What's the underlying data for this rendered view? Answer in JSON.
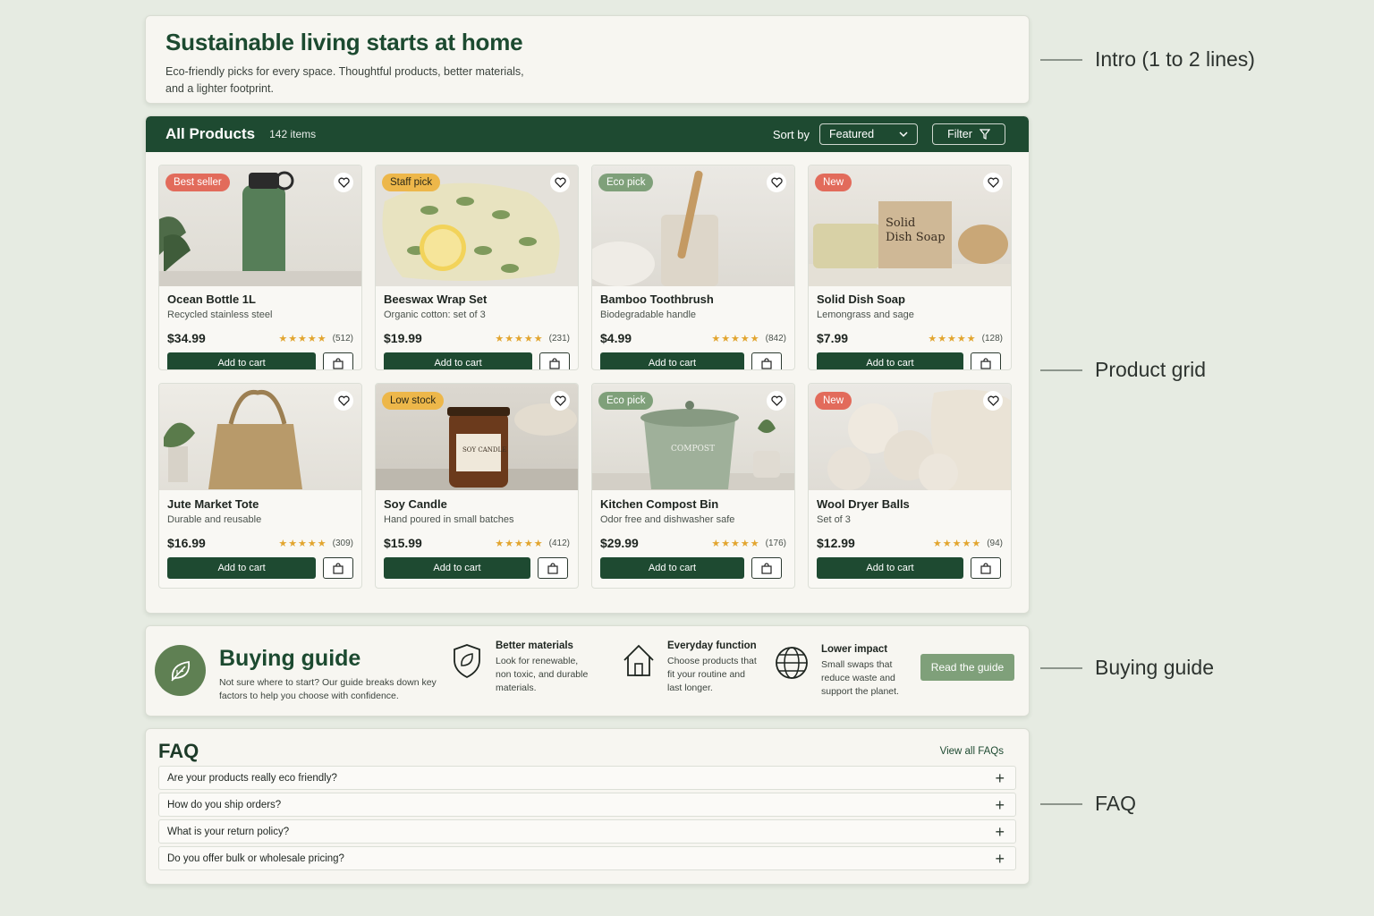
{
  "intro": {
    "title": "Sustainable living starts at home",
    "description": "Eco-friendly picks for every space. Thoughtful products, better materials, and a lighter footprint."
  },
  "grid": {
    "title": "All Products",
    "count": "142 items",
    "sort_label": "Sort by",
    "sort_value": "Featured",
    "filter_label": "Filter",
    "add_to_cart": "Add to cart",
    "products": [
      {
        "badge": "Best seller",
        "badge_color": "#e26b5b",
        "name": "Ocean Bottle 1L",
        "sub": "Recycled stainless steel",
        "price": "$34.99",
        "rating": 4.5,
        "reviews": "(512)"
      },
      {
        "badge": "Staff pick",
        "badge_color": "#edb74a",
        "name": "Beeswax Wrap Set",
        "sub": "Organic cotton: set of 3",
        "price": "$19.99",
        "rating": 4.5,
        "reviews": "(231)"
      },
      {
        "badge": "Eco pick",
        "badge_color": "#7fa07a",
        "name": "Bamboo Toothbrush",
        "sub": "Biodegradable handle",
        "price": "$4.99",
        "rating": 4.5,
        "reviews": "(842)"
      },
      {
        "badge": "New",
        "badge_color": "#e26b5b",
        "name": "Solid Dish Soap",
        "sub": "Lemongrass and sage",
        "price": "$7.99",
        "rating": 4.5,
        "reviews": "(128)"
      },
      {
        "badge": "",
        "badge_color": "",
        "name": "Jute Market Tote",
        "sub": "Durable and reusable",
        "price": "$16.99",
        "rating": 4.5,
        "reviews": "(309)"
      },
      {
        "badge": "Low stock",
        "badge_color": "#edb74a",
        "name": "Soy Candle",
        "sub": "Hand poured in small batches",
        "price": "$15.99",
        "rating": 4.5,
        "reviews": "(412)"
      },
      {
        "badge": "Eco pick",
        "badge_color": "#7fa07a",
        "name": "Kitchen Compost Bin",
        "sub": "Odor free and dishwasher safe",
        "price": "$29.99",
        "rating": 4.5,
        "reviews": "(176)"
      },
      {
        "badge": "New",
        "badge_color": "#e26b5b",
        "name": "Wool Dryer Balls",
        "sub": "Set of 3",
        "price": "$12.99",
        "rating": 4.5,
        "reviews": "(94)"
      }
    ],
    "image_labels": {
      "soap_box": "Solid Dish Soap",
      "candle_label": "SOY CANDLE",
      "compost_label": "COMPOST"
    }
  },
  "guide": {
    "title": "Buying guide",
    "description": "Not sure where to start? Our guide breaks down key factors to help you choose with confidence.",
    "features": [
      {
        "icon": "shield-leaf-icon",
        "title": "Better materials",
        "desc": "Look for renewable, non toxic, and durable materials."
      },
      {
        "icon": "house-icon",
        "title": "Everyday function",
        "desc": "Choose products that fit your routine and last longer."
      },
      {
        "icon": "globe-icon",
        "title": "Lower impact",
        "desc": "Small swaps that reduce waste and support the planet."
      }
    ],
    "button": "Read the guide"
  },
  "faq": {
    "title": "FAQ",
    "view_all": "View all FAQs",
    "items": [
      "Are your products really eco friendly?",
      "How do you ship orders?",
      "What is your return policy?",
      "Do you offer bulk or wholesale pricing?"
    ]
  },
  "annotations": {
    "intro": "Intro (1 to 2 lines)",
    "grid": "Product grid",
    "guide": "Buying guide",
    "faq": "FAQ"
  }
}
